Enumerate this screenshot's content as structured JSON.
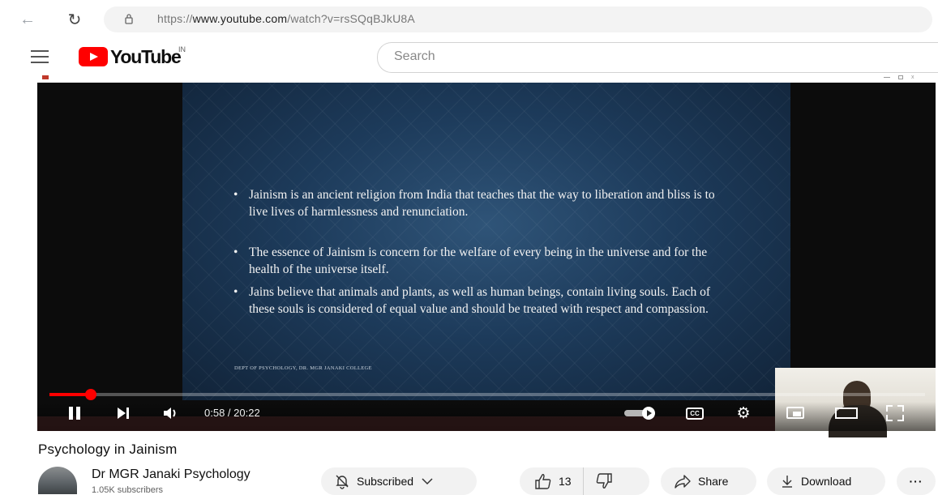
{
  "browser": {
    "url_prefix": "https://",
    "url_domain": "www.youtube.com",
    "url_path": "/watch?v=rsSQqBJkU8A"
  },
  "header": {
    "logo_text": "YouTube",
    "country_code": "IN",
    "search_placeholder": "Search"
  },
  "player": {
    "slide_bullets": [
      "Jainism is an ancient religion from India that teaches that the way to liberation and bliss is to live lives of harmlessness and renunciation.",
      "The essence of Jainism is concern for the welfare of every being in the universe and for the health of the universe itself.",
      "Jains believe that animals and plants, as well as human beings, contain living souls. Each of these souls is considered of equal value and should be treated with respect and compassion."
    ],
    "slide_footer": "DEPT OF PSYCHOLOGY, DR. MGR JANAKI COLLEGE",
    "time_display": "0:58 / 20:22",
    "progress_fraction": 0.047,
    "cc_label": "CC"
  },
  "video": {
    "title": "Psychology in Jainism",
    "channel_name": "Dr MGR Janaki Psychology",
    "subscribers": "1.05K subscribers"
  },
  "actions": {
    "subscribed_label": "Subscribed",
    "like_count": "13",
    "share_label": "Share",
    "download_label": "Download",
    "more_label": "···"
  },
  "colors": {
    "brand_red": "#ff0000",
    "pill_bg": "#f2f2f2"
  }
}
